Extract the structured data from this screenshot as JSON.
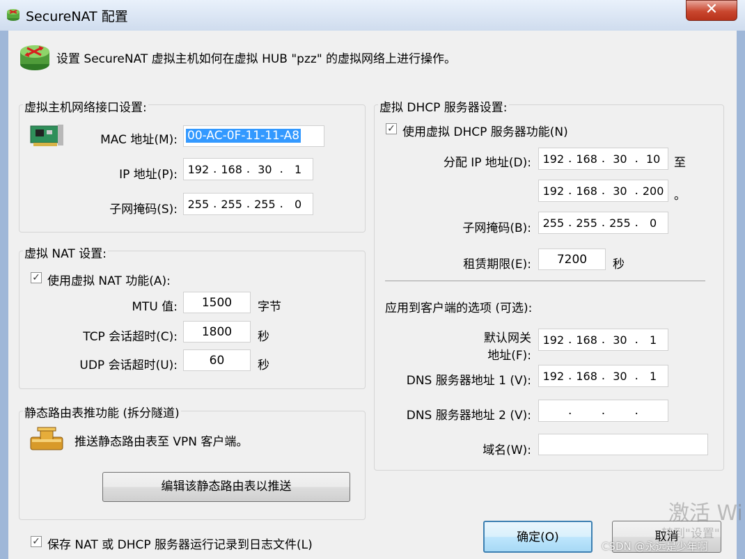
{
  "window": {
    "title": "SecureNAT 配置",
    "close_label": "✕"
  },
  "header": {
    "text": "设置 SecureNAT 虚拟主机如何在虚拟 HUB \"pzz\" 的虚拟网络上进行操作。"
  },
  "host_group": {
    "title": "虚拟主机网络接口设置:",
    "mac_label": "MAC 地址(M):",
    "mac_value": "00-AC-0F-11-11-A8",
    "ip_label": "IP 地址(P):",
    "ip": [
      "192",
      "168",
      "30",
      "1"
    ],
    "mask_label": "子网掩码(S):",
    "mask": [
      "255",
      "255",
      "255",
      "0"
    ]
  },
  "nat_group": {
    "title": "虚拟 NAT 设置:",
    "enable_label": "使用虚拟 NAT 功能(A):",
    "enabled": true,
    "mtu_label": "MTU 值:",
    "mtu": "1500",
    "mtu_unit": "字节",
    "tcp_label": "TCP 会话超时(C):",
    "tcp": "1800",
    "tcp_unit": "秒",
    "udp_label": "UDP 会话超时(U):",
    "udp": "60",
    "udp_unit": "秒"
  },
  "route_group": {
    "title": "静态路由表推功能 (拆分隧道)",
    "desc": "推送静态路由表至 VPN 客户端。",
    "button": "编辑该静态路由表以推送"
  },
  "log_option": {
    "label": "保存 NAT 或 DHCP 服务器运行记录到日志文件(L)",
    "checked": true
  },
  "dhcp_group": {
    "title": "虚拟 DHCP 服务器设置:",
    "enable_label": "使用虚拟 DHCP 服务器功能(N)",
    "enabled": true,
    "range_label": "分配 IP 地址(D):",
    "range_start": [
      "192",
      "168",
      "30",
      "10"
    ],
    "range_to": "至",
    "range_end": [
      "192",
      "168",
      "30",
      "200"
    ],
    "range_end_mark": "。",
    "mask_label": "子网掩码(B):",
    "mask": [
      "255",
      "255",
      "255",
      "0"
    ],
    "lease_label": "租赁期限(E):",
    "lease": "7200",
    "lease_unit": "秒",
    "options_title": "应用到客户端的选项 (可选):",
    "gw_label_1": "默认网关",
    "gw_label_2": "地址(F):",
    "gw": [
      "192",
      "168",
      "30",
      "1"
    ],
    "dns1_label": "DNS 服务器地址 1 (V):",
    "dns1": [
      "192",
      "168",
      "30",
      "1"
    ],
    "dns2_label": "DNS 服务器地址 2 (V):",
    "dns2": [
      "",
      "",
      "",
      ""
    ],
    "domain_label": "域名(W):",
    "domain": ""
  },
  "buttons": {
    "ok": "确定(O)",
    "cancel": "取消"
  },
  "watermarks": {
    "activate_1": "激活 Wi",
    "activate_2": "转到\"设置\"",
    "csdn": "CSDN @永远是少年啊"
  }
}
